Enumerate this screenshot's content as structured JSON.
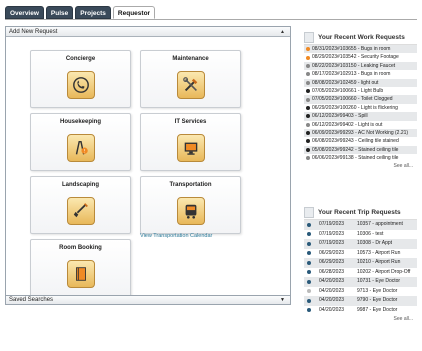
{
  "tabs": [
    {
      "label": "Overview",
      "active": false
    },
    {
      "label": "Pulse",
      "active": false
    },
    {
      "label": "Projects",
      "active": false
    },
    {
      "label": "Requestor",
      "active": true
    }
  ],
  "add_panel": {
    "title": "Add New Request"
  },
  "tiles": [
    {
      "label": "Concierge",
      "icon": "phone-icon"
    },
    {
      "label": "Maintenance",
      "icon": "tools-icon"
    },
    {
      "label": "Housekeeping",
      "icon": "wet-floor-icon"
    },
    {
      "label": "IT Services",
      "icon": "monitor-icon"
    },
    {
      "label": "Landscaping",
      "icon": "shovel-icon"
    },
    {
      "label": "Transportation",
      "icon": "bus-icon"
    },
    {
      "label": "Room Booking",
      "icon": "book-icon"
    }
  ],
  "transport_link": "View Transportation Calendar",
  "saved_searches": "Saved Searches",
  "work_requests": {
    "title": "Your Recent Work Requests",
    "see_all": "See all...",
    "items": [
      {
        "text": "08/31/2023#103655 - Bugs in room",
        "color": "#f08a24"
      },
      {
        "text": "08/29/2023#103542 - Security Footage",
        "color": "#f08a24"
      },
      {
        "text": "08/22/2023#103150 - Leaking Faucet",
        "color": "#888888"
      },
      {
        "text": "08/17/2023#102913 - Bugs in room",
        "color": "#888888"
      },
      {
        "text": "08/08/2023#102459 - light out",
        "color": "#888888"
      },
      {
        "text": "07/05/2023#100661 - Light Bulb",
        "color": "#222222"
      },
      {
        "text": "07/05/2023#100660 - Toilet Clogged",
        "color": "#888888"
      },
      {
        "text": "06/29/2023#100260 - Light is flickering",
        "color": "#222222"
      },
      {
        "text": "06/12/2023#99403 - Spill",
        "color": "#222222"
      },
      {
        "text": "06/12/2023#99402 - Light is out",
        "color": "#888888"
      },
      {
        "text": "06/09/2023#99293 - AC Not Working (2.21)",
        "color": "#222222"
      },
      {
        "text": "06/08/2023#99243 - Ceiling tile stained",
        "color": "#222222"
      },
      {
        "text": "05/08/2023#99242 - Stained ceiling tile",
        "color": "#222222"
      },
      {
        "text": "06/06/2023#99138 - Stained ceiling tile",
        "color": "#888888"
      }
    ]
  },
  "trip_requests": {
    "title": "Your Recent Trip Requests",
    "see_all": "See all...",
    "items": [
      {
        "date": "07/19/2023",
        "text": "10357 - appointment",
        "color": "#2a5a7a"
      },
      {
        "date": "07/19/2023",
        "text": "10306 - test",
        "color": "#2a5a7a"
      },
      {
        "date": "07/19/2023",
        "text": "10308 - Dr Appt",
        "color": "#2a5a7a"
      },
      {
        "date": "06/29/2023",
        "text": "10573 - Airport Run",
        "color": "#2a5a7a"
      },
      {
        "date": "06/29/2023",
        "text": "10210 - Airport Run",
        "color": "#2a5a7a"
      },
      {
        "date": "06/28/2023",
        "text": "10202 - Airport Drop-Off",
        "color": "#2a5a7a"
      },
      {
        "date": "04/20/2023",
        "text": "10731 - Eye Doctor",
        "color": "#2a5a7a"
      },
      {
        "date": "04/20/2023",
        "text": "9713 - Eye Doctor",
        "color": "#bbbbbb"
      },
      {
        "date": "04/20/2023",
        "text": "9790 - Eye Doctor",
        "color": "#2a5a7a"
      },
      {
        "date": "04/20/2023",
        "text": "9987 - Eye Doctor",
        "color": "#2a5a7a"
      }
    ]
  }
}
